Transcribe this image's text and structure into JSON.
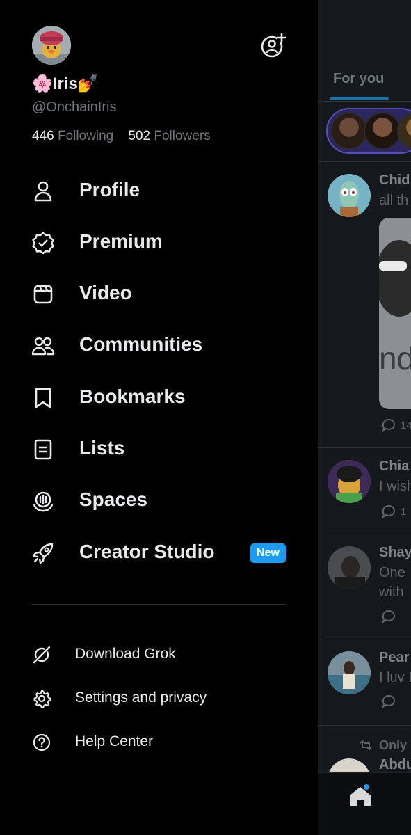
{
  "profile": {
    "display_name": "🌸Iris💅",
    "handle": "@OnchainIris",
    "following_count": "446",
    "following_label": "Following",
    "followers_count": "502",
    "followers_label": "Followers"
  },
  "nav": {
    "items": [
      {
        "label": "Profile",
        "icon": "person-icon"
      },
      {
        "label": "Premium",
        "icon": "verified-badge-icon"
      },
      {
        "label": "Video",
        "icon": "video-icon"
      },
      {
        "label": "Communities",
        "icon": "communities-icon"
      },
      {
        "label": "Bookmarks",
        "icon": "bookmark-icon"
      },
      {
        "label": "Lists",
        "icon": "list-icon"
      },
      {
        "label": "Spaces",
        "icon": "spaces-icon"
      },
      {
        "label": "Creator Studio",
        "icon": "rocket-icon",
        "badge": "New"
      }
    ]
  },
  "secondary": {
    "items": [
      {
        "label": "Download Grok",
        "icon": "grok-icon"
      },
      {
        "label": "Settings and privacy",
        "icon": "gear-icon"
      },
      {
        "label": "Help Center",
        "icon": "help-icon"
      }
    ]
  },
  "feed": {
    "tab_label": "For you",
    "tweets": [
      {
        "name": "Chid",
        "text": "all th",
        "reply_count": "14"
      },
      {
        "name": "Chia",
        "text": "I wish",
        "reply_count": "1"
      },
      {
        "name": "Shay",
        "text": "One",
        "text2": "with"
      },
      {
        "name": "Pear",
        "text": "I luv I"
      },
      {
        "name": "Abdu",
        "retweet_label": "Only"
      }
    ]
  },
  "colors": {
    "accent": "#1d9bf0",
    "text_primary": "#e7e9ea",
    "text_secondary": "#71767b",
    "background": "#000000"
  }
}
